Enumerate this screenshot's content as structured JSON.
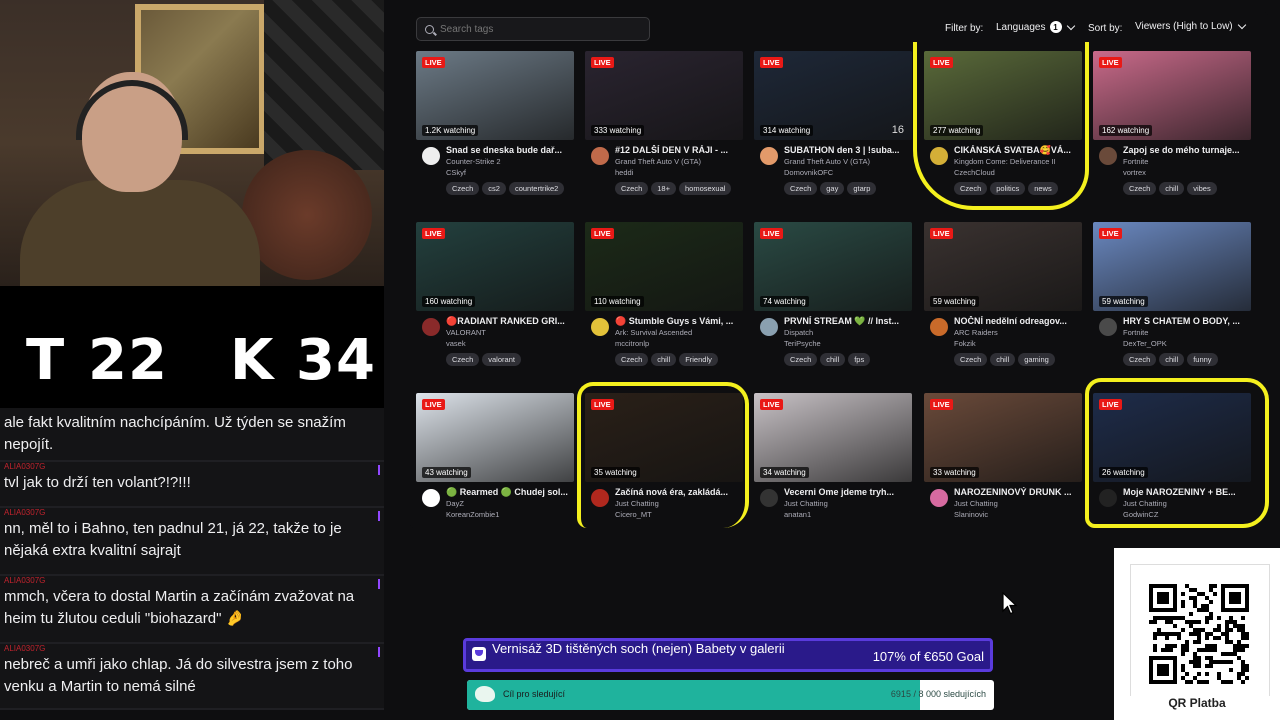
{
  "score": {
    "t_label": "T",
    "t_value": "22",
    "k_label": "K",
    "k_value": "34"
  },
  "chat": [
    {
      "user": "",
      "text": "ale fakt kvalitním nachcípáním. Už týden se snažím nepojít."
    },
    {
      "user": "ALIA0307G",
      "text": "tvl jak to drží ten volant?!?!!!"
    },
    {
      "user": "ALIA0307G",
      "text": "nn, měl to i Bahno, ten padnul 21, já 22, takže to je nějaká extra kvalitní sajrajt"
    },
    {
      "user": "ALIA0307G",
      "text": "mmch, včera to dostal Martin a začínám zvažovat na heim tu žlutou ceduli \"biohazard\" 🤌"
    },
    {
      "user": "ALIA0307G",
      "text": "nebreč a umři jako chlap. Já do silvestra jsem z toho venku a Martin to nemá silné"
    }
  ],
  "browse": {
    "search_placeholder": "Search tags",
    "filter_label": "Filter by:",
    "languages_label": "Languages",
    "languages_count": "1",
    "sort_label": "Sort by:",
    "sort_value": "Viewers (High to Low)",
    "live_label": "LIVE",
    "cards": [
      {
        "title": "Snad se dneska bude dař...",
        "game": "Counter-Strike 2",
        "channel": "CSkyf",
        "viewers": "1.2K watching",
        "tags": [
          "Czech",
          "cs2",
          "countertrike2"
        ],
        "thumb": "#6c7a86",
        "avatar": "#eee",
        "overlay": ""
      },
      {
        "title": "#12 DALŠÍ DEN V RÁJI - ...",
        "game": "Grand Theft Auto V (GTA)",
        "channel": "heddi",
        "viewers": "333 watching",
        "tags": [
          "Czech",
          "18+",
          "homosexual"
        ],
        "thumb": "#2a2430",
        "avatar": "#c06a4a",
        "overlay": ""
      },
      {
        "title": "SUBATHON den 3 | !suba...",
        "game": "Grand Theft Auto V (GTA)",
        "channel": "DomovnikOFC",
        "viewers": "314 watching",
        "tags": [
          "Czech",
          "gay",
          "gtarp"
        ],
        "thumb": "#1e2838",
        "avatar": "#e39a6a",
        "overlay": "16"
      },
      {
        "title": "CIKÁNSKÁ SVATBA🥰VÁ...",
        "game": "Kingdom Come: Deliverance II",
        "channel": "CzechCloud",
        "viewers": "277 watching",
        "tags": [
          "Czech",
          "politics",
          "news"
        ],
        "thumb": "#5a6a3a",
        "avatar": "#d4af37",
        "overlay": ""
      },
      {
        "title": "Zapoj se do mého turnaje...",
        "game": "Fortnite",
        "channel": "vortrex",
        "viewers": "162 watching",
        "tags": [
          "Czech",
          "chill",
          "vibes"
        ],
        "thumb": "#c96a8a",
        "avatar": "#6a4a3a",
        "overlay": ""
      },
      {
        "title": "🔴RADIANT RANKED GRI...",
        "game": "VALORANT",
        "channel": "vasek",
        "viewers": "160 watching",
        "tags": [
          "Czech",
          "valorant"
        ],
        "thumb": "#23403e",
        "avatar": "#8a2a2a",
        "overlay": ""
      },
      {
        "title": "🔴 Stumble Guys s Vámi, ...",
        "game": "Ark: Survival Ascended",
        "channel": "mccitronlp",
        "viewers": "110 watching",
        "tags": [
          "Czech",
          "chill",
          "Friendly"
        ],
        "thumb": "#1c2a18",
        "avatar": "#e3c23a",
        "overlay": ""
      },
      {
        "title": "PRVNÍ STREAM 💚 // Inst...",
        "game": "Dispatch",
        "channel": "TeriPsyche",
        "viewers": "74 watching",
        "tags": [
          "Czech",
          "chill",
          "fps"
        ],
        "thumb": "#2a4a44",
        "avatar": "#8aa0b0",
        "overlay": ""
      },
      {
        "title": "NOČNÍ nedělní odreagov...",
        "game": "ARC Raiders",
        "channel": "Fokzik",
        "viewers": "59 watching",
        "tags": [
          "Czech",
          "chill",
          "gaming"
        ],
        "thumb": "#3a3230",
        "avatar": "#c96a2a",
        "overlay": ""
      },
      {
        "title": "HRY S CHATEM O BODY, ...",
        "game": "Fortnite",
        "channel": "DexTer_OPK",
        "viewers": "59 watching",
        "tags": [
          "Czech",
          "chill",
          "funny"
        ],
        "thumb": "#6a88c0",
        "avatar": "#4a4a4a",
        "overlay": ""
      },
      {
        "title": "🟢 Rearmed 🟢 Chudej sol...",
        "game": "DayZ",
        "channel": "KoreanZombie1",
        "viewers": "43 watching",
        "tags": [],
        "thumb": "#dde3ea",
        "avatar": "#ffffff",
        "overlay": ""
      },
      {
        "title": "Začíná nová éra, zakládá...",
        "game": "Just Chatting",
        "channel": "Cicero_MT",
        "viewers": "35 watching",
        "tags": [],
        "thumb": "#2a2018",
        "avatar": "#b0281e",
        "overlay": ""
      },
      {
        "title": "Vecerni Ome jdeme tryh...",
        "game": "Just Chatting",
        "channel": "anatan1",
        "viewers": "34 watching",
        "tags": [],
        "thumb": "#c8c2c6",
        "avatar": "#333",
        "overlay": ""
      },
      {
        "title": "NAROZENINOVÝ DRUNK ...",
        "game": "Just Chatting",
        "channel": "Slaninovic",
        "viewers": "33 watching",
        "tags": [],
        "thumb": "#6a4a3a",
        "avatar": "#d66aa0",
        "overlay": ""
      },
      {
        "title": "Moje NAROZENINY + BE...",
        "game": "Just Chatting",
        "channel": "GodwinCZ",
        "viewers": "26 watching",
        "tags": [],
        "thumb": "#1e2c4a",
        "avatar": "#222",
        "overlay": ""
      }
    ]
  },
  "goal1": {
    "title": "Vernisáž 3D tištěných soch (nejen) Babety v galerii",
    "progress": "107% of €650 Goal"
  },
  "goal2": {
    "title": "Cíl pro sledující",
    "progress": "6915 / 8 000 sledujících",
    "fraction": 0.86
  },
  "qr": {
    "label": "QR Platba"
  },
  "colors": {
    "live": "#e91916",
    "highlight": "#f4f01e",
    "goal_purple": "#2a1a8a",
    "goal_teal": "#1fb39d"
  }
}
